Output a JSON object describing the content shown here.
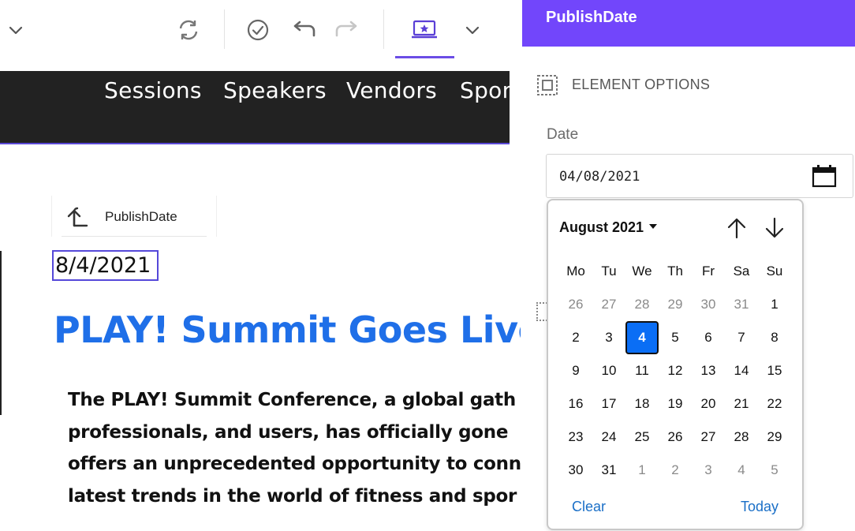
{
  "toolbar": {
    "icons": [
      "chevron-down-icon",
      "refresh-icon",
      "check-circle-icon",
      "undo-icon",
      "redo-icon",
      "device-preview-icon",
      "chevron-down-icon"
    ]
  },
  "site_nav": {
    "items": [
      "Sessions",
      "Speakers",
      "Vendors",
      "Spon"
    ]
  },
  "page": {
    "field_chip_label": "PublishDate",
    "date_value": "8/4/2021",
    "headline": "PLAY! Summit Goes Live",
    "body_lines": [
      "The PLAY! Summit Conference, a global gath",
      "professionals, and users, has officially gone",
      "offers an unprecedented opportunity to conn",
      "latest trends in the world of fitness and spor"
    ]
  },
  "panel": {
    "title": "PublishDate",
    "section_label": "ELEMENT OPTIONS",
    "field_label": "Date",
    "date_input_value": "04/08/2021"
  },
  "calendar": {
    "month_label": "August 2021",
    "weekdays": [
      "Mo",
      "Tu",
      "We",
      "Th",
      "Fr",
      "Sa",
      "Su"
    ],
    "weeks": [
      [
        "26",
        "27",
        "28",
        "29",
        "30",
        "31",
        "1"
      ],
      [
        "2",
        "3",
        "4",
        "5",
        "6",
        "7",
        "8"
      ],
      [
        "9",
        "10",
        "11",
        "12",
        "13",
        "14",
        "15"
      ],
      [
        "16",
        "17",
        "18",
        "19",
        "20",
        "21",
        "22"
      ],
      [
        "23",
        "24",
        "25",
        "26",
        "27",
        "28",
        "29"
      ],
      [
        "30",
        "31",
        "1",
        "2",
        "3",
        "4",
        "5"
      ]
    ],
    "other_month": [
      [
        true,
        true,
        true,
        true,
        true,
        true,
        false
      ],
      [
        false,
        false,
        false,
        false,
        false,
        false,
        false
      ],
      [
        false,
        false,
        false,
        false,
        false,
        false,
        false
      ],
      [
        false,
        false,
        false,
        false,
        false,
        false,
        false
      ],
      [
        false,
        false,
        false,
        false,
        false,
        false,
        false
      ],
      [
        false,
        false,
        true,
        true,
        true,
        true,
        true
      ]
    ],
    "selected_day": "4",
    "clear_label": "Clear",
    "today_label": "Today"
  },
  "colors": {
    "accent": "#7246fb",
    "selected_day": "#0a6ef5",
    "headline": "#1f6fe8",
    "nav_bg": "#222222",
    "link": "#1a6fc7"
  }
}
